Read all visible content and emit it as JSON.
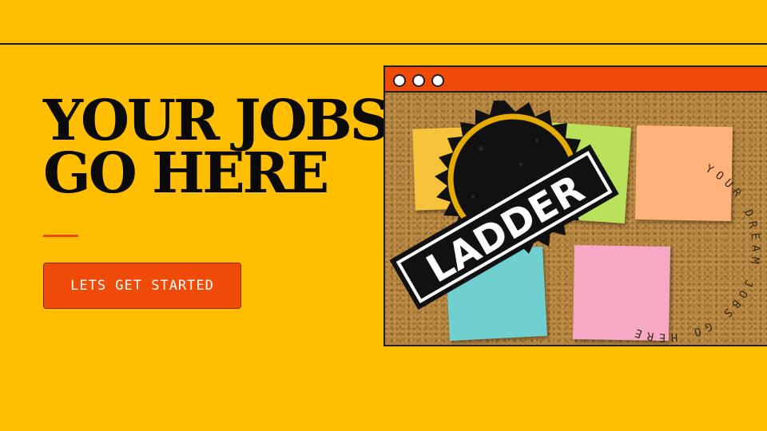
{
  "hero": {
    "headline_line1": "YOUR JOBS",
    "headline_line2": "GO HERE",
    "cta_label": "LETS GET STARTED"
  },
  "board": {
    "logo_text": "LADDER",
    "circular_text": "YOUR DREAM JOBS GO HERE"
  },
  "colors": {
    "background": "#FFBE00",
    "accent": "#F04A08",
    "text": "#0a0a0a"
  }
}
